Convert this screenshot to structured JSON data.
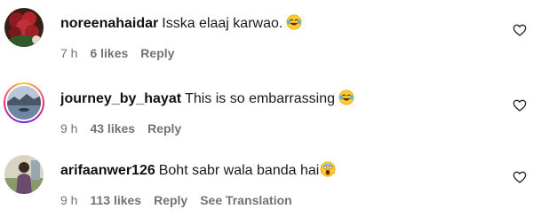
{
  "comments": [
    {
      "username": "noreenahaidar",
      "text": "Isska elaaj karwao.",
      "emoji": "face-with-tears-of-joy",
      "time": "7 h",
      "likes": "6 likes",
      "reply": "Reply",
      "avatar": "roses-avatar",
      "like_icon": "heart-outline-icon"
    },
    {
      "username": "journey_by_hayat",
      "text": "This is so embarrassing",
      "emoji": "face-with-tears-of-joy",
      "time": "9 h",
      "likes": "43 likes",
      "reply": "Reply",
      "avatar": "landscape-avatar-story-ring",
      "like_icon": "heart-outline-icon"
    },
    {
      "username": "arifaanwer126",
      "text": "Boht sabr wala banda hai",
      "emoji": "face-screaming-in-fear",
      "time": "9 h",
      "likes": "113 likes",
      "reply": "Reply",
      "see_translation": "See Translation",
      "avatar": "person-outdoor-avatar",
      "like_icon": "heart-outline-icon"
    }
  ],
  "colors": {
    "username": "#111111",
    "meta": "#737373",
    "background": "#ffffff",
    "story_ring": [
      "#f9ce34",
      "#ee2a7b",
      "#6228d7"
    ]
  }
}
